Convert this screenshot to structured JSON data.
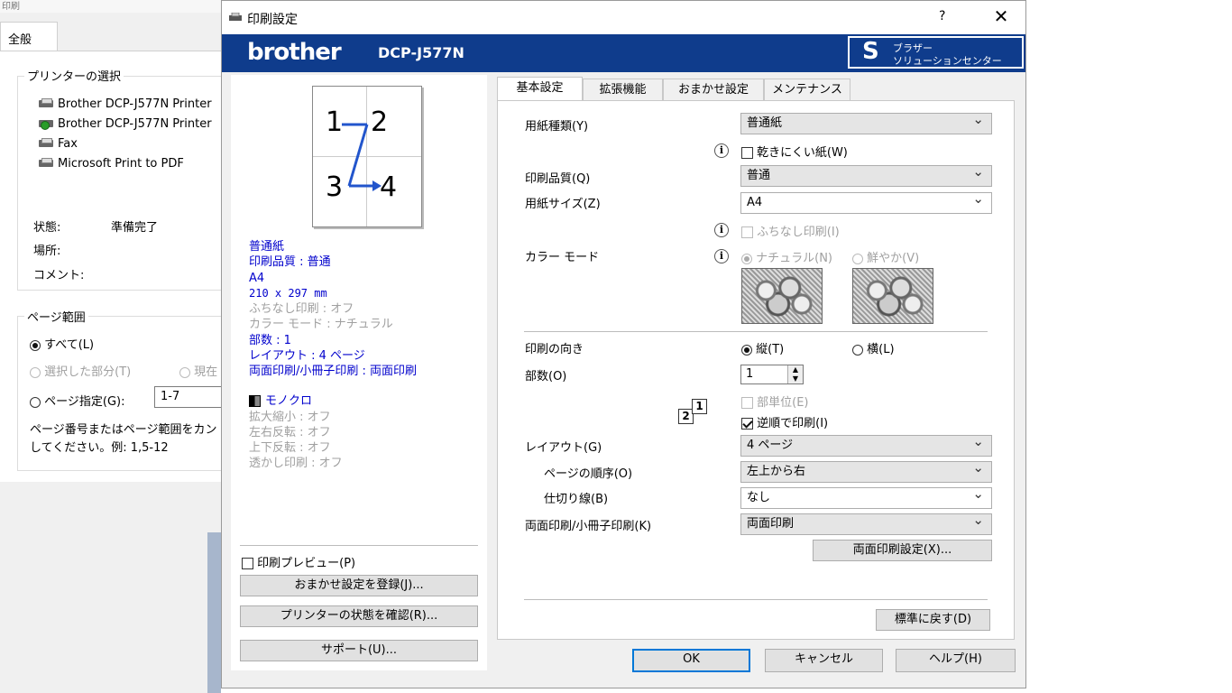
{
  "background_dialog": {
    "top_text": "印刷",
    "tab_general": "全般",
    "printer_select_title": "プリンターの選択",
    "printers": [
      "Brother DCP-J577N Printer",
      "Brother DCP-J577N Printer",
      "Fax",
      "Microsoft Print to PDF"
    ],
    "status_label": "状態:",
    "status_value": "準備完了",
    "location_label": "場所:",
    "comment_label": "コメント:",
    "page_range_title": "ページ範囲",
    "range_all": "すべて(L)",
    "range_selection": "選択した部分(T)",
    "range_current": "現在",
    "range_pages": "ページ指定(G):",
    "range_pages_value": "1-7",
    "range_help_1": "ページ番号またはページ範囲をカン",
    "range_help_2": "してください。例: 1,5-12"
  },
  "dialog": {
    "title": "印刷設定",
    "help_button": "?",
    "close_button": "✕",
    "brand": "brother",
    "model": "DCP-J577N",
    "solution_center_line1": "ブラザー",
    "solution_center_line2": "ソリューションセンター"
  },
  "preview": {
    "page_numbers": [
      "1",
      "2",
      "3",
      "4"
    ],
    "summary_blue": [
      "普通紙",
      "印刷品質 : 普通",
      "A4",
      "210 x 297 mm"
    ],
    "summary_gray": [
      "ふちなし印刷 : オフ",
      "カラー モード : ナチュラル"
    ],
    "summary_blue2": [
      "部数 : 1",
      "レイアウト : 4 ページ",
      "両面印刷/小冊子印刷 : 両面印刷"
    ],
    "mono_label": "モノクロ",
    "summary_gray2": [
      "拡大縮小 : オフ",
      "左右反転 : オフ",
      "上下反転 : オフ",
      "透かし印刷 : オフ"
    ],
    "print_preview_label": "印刷プレビュー(P)",
    "register_button": "おまかせ設定を登録(J)...",
    "check_status_button": "プリンターの状態を確認(R)...",
    "support_button": "サポート(U)..."
  },
  "tabs": [
    "基本設定",
    "拡張機能",
    "おまかせ設定",
    "メンテナンス"
  ],
  "basic": {
    "media_type_label": "用紙種類(Y)",
    "media_type_value": "普通紙",
    "slow_dry_label": "乾きにくい紙(W)",
    "quality_label": "印刷品質(Q)",
    "quality_value": "普通",
    "paper_size_label": "用紙サイズ(Z)",
    "paper_size_value": "A4",
    "borderless_label": "ふちなし印刷(I)",
    "color_mode_label": "カラー モード",
    "color_natural": "ナチュラル(N)",
    "color_vivid": "鮮やか(V)",
    "orientation_label": "印刷の向き",
    "portrait": "縦(T)",
    "landscape": "横(L)",
    "copies_label": "部数(O)",
    "copies_value": "1",
    "collate_label": "部単位(E)",
    "reverse_label": "逆順で印刷(I)",
    "collate_icon_top": "1",
    "collate_icon_bottom": "2",
    "layout_label": "レイアウト(G)",
    "layout_value": "4 ページ",
    "page_order_label": "ページの順序(O)",
    "page_order_value": "左上から右",
    "border_line_label": "仕切り線(B)",
    "border_line_value": "なし",
    "duplex_label": "両面印刷/小冊子印刷(K)",
    "duplex_value": "両面印刷",
    "duplex_settings_button": "両面印刷設定(X)...",
    "default_button": "標準に戻す(D)"
  },
  "footer": {
    "ok": "OK",
    "cancel": "キャンセル",
    "help": "ヘルプ(H)"
  }
}
